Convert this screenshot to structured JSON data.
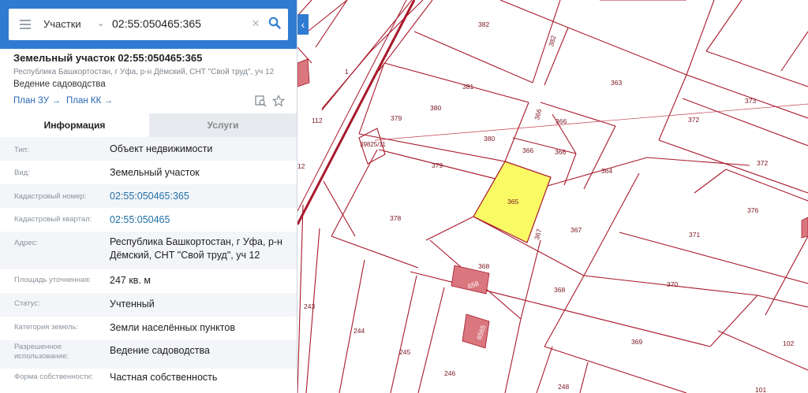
{
  "search": {
    "type_label": "Участки",
    "query": "02:55:050465:365"
  },
  "parcel": {
    "title": "Земельный участок 02:55:050465:365",
    "address_short": "Республика Башкортостан, г Уфа, р-н Дёмский, СНТ \"Свой труд\", уч 12",
    "use": "Ведение садоводства",
    "link_zu": "План ЗУ →",
    "link_kk": "План КК →"
  },
  "tabs": {
    "info": "Информация",
    "services": "Услуги"
  },
  "rows": [
    {
      "label": "Тип:",
      "value": "Объект недвижимости"
    },
    {
      "label": "Вид:",
      "value": "Земельный участок"
    },
    {
      "label": "Кадастровый номер:",
      "value": "02:55:050465:365"
    },
    {
      "label": "Кадастровый квартал:",
      "value": "02:55:050465"
    },
    {
      "label": "Адрес:",
      "value": "Республика Башкортостан, г Уфа, р-н Дёмский, СНТ \"Свой труд\", уч 12"
    },
    {
      "label": "Площадь уточненная:",
      "value": "247 кв. м"
    },
    {
      "label": "Статус:",
      "value": "Учтенный"
    },
    {
      "label": "Категория земель:",
      "value": "Земли населённых пунктов"
    },
    {
      "label": "Разрешенное использование:",
      "value": "Ведение садоводства"
    },
    {
      "label": "Форма собственности:",
      "value": "Частная собственность"
    }
  ],
  "map_labels": {
    "l382": "382",
    "l382b": "382",
    "l363": "363",
    "l373": "373",
    "l381": "381",
    "l380": "380",
    "l380b": "380",
    "l1": "1",
    "l112": "112",
    "l12": "12",
    "l379": "379",
    "l379b": "379",
    "l39825": "39825/11",
    "l366a": "366",
    "l366b": "366",
    "l366c": "366",
    "l366d": "366",
    "l372": "372",
    "l372b": "372",
    "l364": "364",
    "l365": "365",
    "l376": "376",
    "l378": "378",
    "l367": "367",
    "l367b": "367",
    "l371": "371",
    "l368": "368",
    "l368b": "368",
    "l658": "658",
    "l370": "370",
    "l243": "243",
    "l244": "244",
    "l245": "245",
    "l246": "246",
    "l248": "248",
    "l369": "369",
    "l102": "102",
    "l101": "101",
    "l6565": "6565"
  },
  "colors": {
    "header_blue": "#2f7bd1",
    "parcel_line": "#a8192b",
    "selected_fill": "#fafa64",
    "building_fill": "#d9767e"
  }
}
